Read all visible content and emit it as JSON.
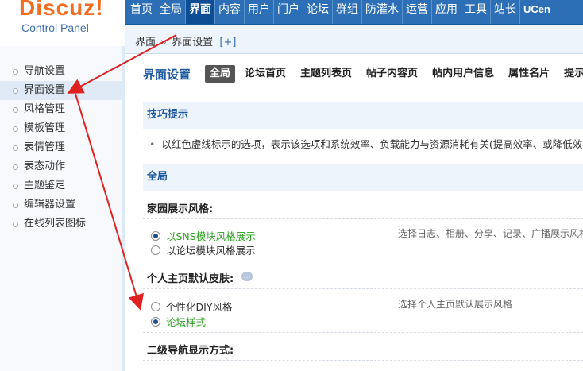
{
  "logo": {
    "word": "Discuz!",
    "sub": "Control Panel"
  },
  "topnav": [
    "首页",
    "全局",
    "界面",
    "内容",
    "用户",
    "门户",
    "论坛",
    "群组",
    "防灌水",
    "运营",
    "应用",
    "工具",
    "站长",
    "UCen"
  ],
  "breadcrumb": {
    "root": "界面",
    "sep": "»",
    "current": "界面设置",
    "plus": "[+]"
  },
  "sidebar": [
    "导航设置",
    "界面设置",
    "风格管理",
    "模板管理",
    "表情管理",
    "表态动作",
    "主题鉴定",
    "编辑器设置",
    "在线列表图标"
  ],
  "page": {
    "title": "界面设置",
    "tabs": [
      "全局",
      "论坛首页",
      "主题列表页",
      "帖子内容页",
      "帖内用户信息",
      "属性名片",
      "提示"
    ]
  },
  "tips": {
    "heading": "技巧提示",
    "text": "以红色虚线标示的选项，表示该选项和系统效率、负载能力与资源消耗有关(提高效率、或降低效率)，"
  },
  "section": {
    "heading": "全局"
  },
  "settings": {
    "home_style": {
      "title": "家园展示风格:",
      "options": [
        "以SNS模块风格展示",
        "以论坛模块风格展示"
      ],
      "selected": 0,
      "hint": "选择日志、相册、分享、记录、广播展示风格"
    },
    "personal_skin": {
      "title": "个人主页默认皮肤:",
      "options": [
        "个性化DIY风格",
        "论坛样式"
      ],
      "selected": 1,
      "hint": "选择个人主页默认展示风格"
    },
    "subnav_mode": {
      "title": "二级导航显示方式:"
    }
  },
  "colors": {
    "nav_blue": "#2d6fb6",
    "active_nav": "#0e4d94",
    "accent_green": "#2aa021",
    "arrow_red": "#e02020",
    "logo_orange": "#f26c22"
  }
}
